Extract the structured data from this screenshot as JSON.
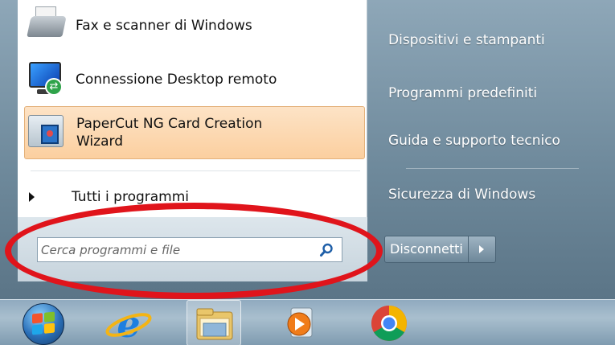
{
  "programs": [
    {
      "label": "Fax e scanner di Windows",
      "icon": "fax-scanner-icon"
    },
    {
      "label": "Connessione Desktop remoto",
      "icon": "remote-desktop-icon"
    },
    {
      "label_line1": "PaperCut NG Card Creation",
      "label_line2": "Wizard",
      "icon": "papercut-card-icon",
      "highlighted": true
    }
  ],
  "all_programs": {
    "label": "Tutti i programmi"
  },
  "search": {
    "placeholder": "Cerca programmi e file",
    "value": ""
  },
  "right_pane": {
    "items": [
      "Dispositivi e stampanti",
      "Programmi predefiniti",
      "Guida e supporto tecnico",
      "Sicurezza di Windows"
    ]
  },
  "shutdown": {
    "label": "Disconnetti"
  },
  "taskbar": {
    "items": [
      "start-orb",
      "internet-explorer-icon",
      "windows-explorer-icon",
      "media-player-icon",
      "chrome-icon"
    ]
  },
  "colors": {
    "highlight_ellipse": "#e0141b",
    "selected_item": "#fbcf9f"
  }
}
